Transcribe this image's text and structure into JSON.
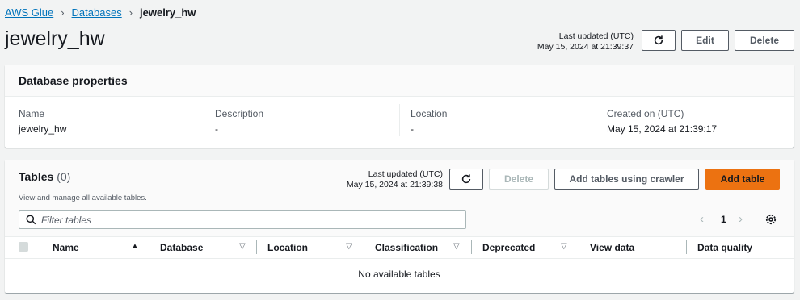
{
  "breadcrumb": {
    "items": [
      "AWS Glue",
      "Databases"
    ],
    "separator": "›",
    "current": "jewelry_hw"
  },
  "page": {
    "title": "jewelry_hw",
    "last_updated_label": "Last updated (UTC)",
    "last_updated_value": "May 15, 2024 at 21:39:37",
    "edit_label": "Edit",
    "delete_label": "Delete"
  },
  "database_properties": {
    "title": "Database properties",
    "fields": [
      {
        "label": "Name",
        "value": "jewelry_hw"
      },
      {
        "label": "Description",
        "value": "-"
      },
      {
        "label": "Location",
        "value": "-"
      },
      {
        "label": "Created on (UTC)",
        "value": "May 15, 2024 at 21:39:17"
      }
    ]
  },
  "tables": {
    "title": "Tables",
    "count": "(0)",
    "description": "View and manage all available tables.",
    "last_updated_label": "Last updated (UTC)",
    "last_updated_value": "May 15, 2024 at 21:39:38",
    "delete_label": "Delete",
    "crawler_label": "Add tables using crawler",
    "add_label": "Add table",
    "filter_placeholder": "Filter tables",
    "current_page": "1",
    "columns": [
      "Name",
      "Database",
      "Location",
      "Classification",
      "Deprecated",
      "View data",
      "Data quality"
    ],
    "sort_glyphs": {
      "active": "▲",
      "inactive": "▽"
    },
    "empty_message": "No available tables"
  },
  "icons": {
    "refresh": "refresh-icon",
    "search": "search-icon",
    "settings": "gear-icon",
    "prev": "chevron-left-icon",
    "next": "chevron-right-icon"
  },
  "colors": {
    "link": "#0073bb",
    "primary_button": "#ec7211",
    "background": "#f2f3f3"
  }
}
